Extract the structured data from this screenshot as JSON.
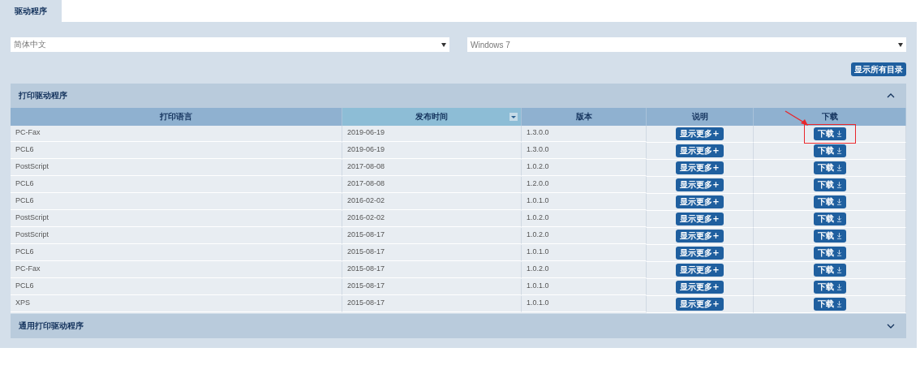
{
  "tabs": [
    {
      "label": "驱动程序",
      "selected": true
    }
  ],
  "filters": [
    {
      "value": "简体中文"
    },
    {
      "value": "Windows 7"
    }
  ],
  "show_all_button": "显示所有目录",
  "sections": [
    {
      "title": "打印驱动程序",
      "expanded": true,
      "table": {
        "columns": [
          {
            "label": "打印语言",
            "sorted": false
          },
          {
            "label": "发布时间",
            "sorted": true
          },
          {
            "label": "版本",
            "sorted": false
          },
          {
            "label": "说明",
            "sorted": false
          },
          {
            "label": "下载",
            "sorted": false
          }
        ],
        "rows": [
          {
            "language": "PC-Fax",
            "date": "2019-06-19",
            "version": "1.3.0.0",
            "more_button": "显示更多+",
            "download_button": "下载",
            "highlighted": true
          },
          {
            "language": "PCL6",
            "date": "2019-06-19",
            "version": "1.3.0.0",
            "more_button": "显示更多+",
            "download_button": "下载",
            "highlighted": false
          },
          {
            "language": "PostScript",
            "date": "2017-08-08",
            "version": "1.0.2.0",
            "more_button": "显示更多+",
            "download_button": "下载",
            "highlighted": false
          },
          {
            "language": "PCL6",
            "date": "2017-08-08",
            "version": "1.2.0.0",
            "more_button": "显示更多+",
            "download_button": "下载",
            "highlighted": false
          },
          {
            "language": "PCL6",
            "date": "2016-02-02",
            "version": "1.0.1.0",
            "more_button": "显示更多+",
            "download_button": "下载",
            "highlighted": false
          },
          {
            "language": "PostScript",
            "date": "2016-02-02",
            "version": "1.0.2.0",
            "more_button": "显示更多+",
            "download_button": "下载",
            "highlighted": false
          },
          {
            "language": "PostScript",
            "date": "2015-08-17",
            "version": "1.0.2.0",
            "more_button": "显示更多+",
            "download_button": "下载",
            "highlighted": false
          },
          {
            "language": "PCL6",
            "date": "2015-08-17",
            "version": "1.0.1.0",
            "more_button": "显示更多+",
            "download_button": "下载",
            "highlighted": false
          },
          {
            "language": "PC-Fax",
            "date": "2015-08-17",
            "version": "1.0.2.0",
            "more_button": "显示更多+",
            "download_button": "下载",
            "highlighted": false
          },
          {
            "language": "PCL6",
            "date": "2015-08-17",
            "version": "1.0.1.0",
            "more_button": "显示更多+",
            "download_button": "下载",
            "highlighted": false
          },
          {
            "language": "XPS",
            "date": "2015-08-17",
            "version": "1.0.1.0",
            "more_button": "显示更多+",
            "download_button": "下载",
            "highlighted": false
          }
        ]
      }
    },
    {
      "title": "通用打印驱动程序",
      "expanded": false
    }
  ]
}
